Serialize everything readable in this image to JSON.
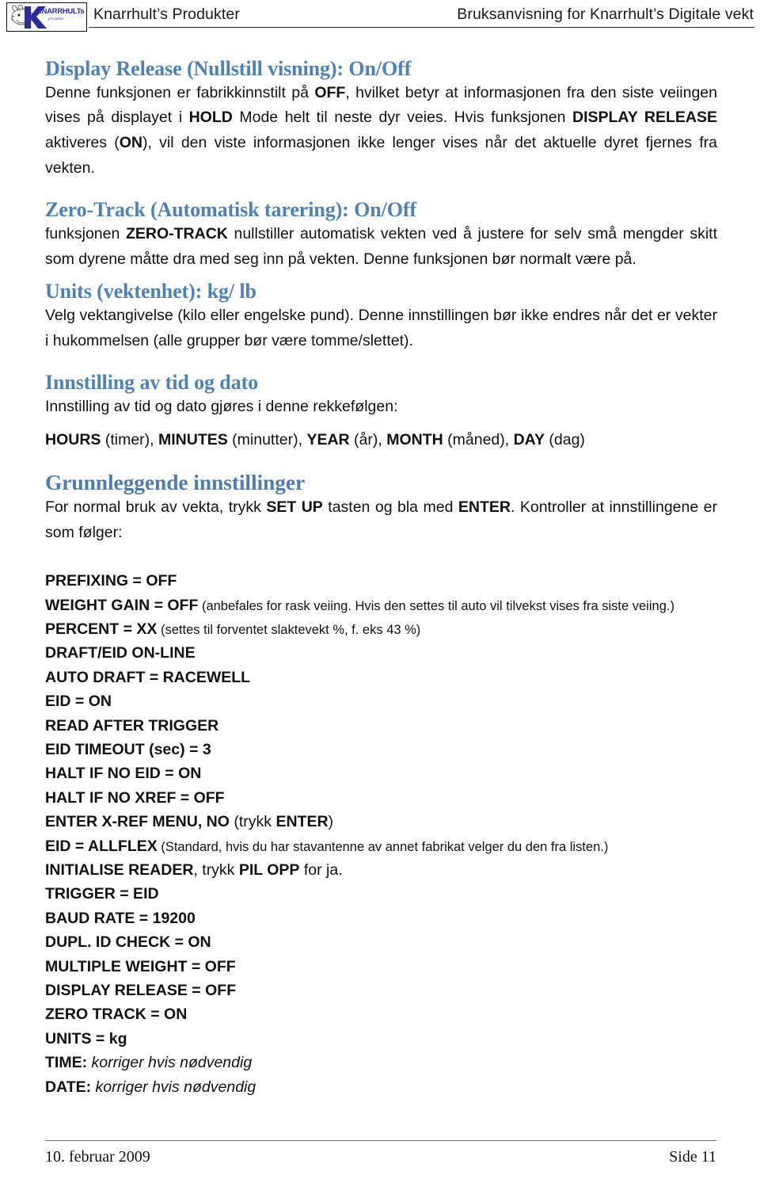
{
  "header": {
    "logo_alt": "Knarrhult's Produkter logo",
    "logo_brand": "KNARRHULTs",
    "logo_sub": "produkter",
    "left_title": "Knarrhult’s Produkter",
    "right_title": "Bruksanvisning for Knarrhult’s Digitale vekt"
  },
  "colors": {
    "heading_blue": "#4E81B6",
    "logo_blue": "#2B2B9E",
    "rule_gray": "#6F6F6F",
    "text_black": "#111111"
  },
  "sections": [
    {
      "heading": "Display Release (Nullstill visning): On/Off",
      "paragraphs": [
        {
          "runs": [
            {
              "t": "Denne funksjonen er fabrikkinnstilt på ",
              "b": false
            },
            {
              "t": "OFF",
              "b": true
            },
            {
              "t": ", hvilket betyr at informasjonen fra den siste veiingen vises på displayet i ",
              "b": false
            },
            {
              "t": "HOLD",
              "b": true
            },
            {
              "t": " Mode helt til neste dyr veies. Hvis funksjonen ",
              "b": false
            },
            {
              "t": "DISPLAY RELEASE",
              "b": true
            },
            {
              "t": " aktiveres (",
              "b": false
            },
            {
              "t": "ON",
              "b": true
            },
            {
              "t": "), vil den viste informasjonen ikke lenger vises når det aktuelle dyret fjernes fra vekten.",
              "b": false
            }
          ]
        }
      ]
    },
    {
      "heading": "Zero-Track (Automatisk tarering): On/Off",
      "paragraphs": [
        {
          "runs": [
            {
              "t": "funksjonen ",
              "b": false
            },
            {
              "t": "ZERO-TRACK",
              "b": true
            },
            {
              "t": " nullstiller automatisk vekten ved å justere for selv små mengder skitt som dyrene måtte dra med seg inn på vekten. Denne funksjonen bør normalt være på.",
              "b": false
            }
          ]
        }
      ]
    },
    {
      "heading": "Units (vektenhet): kg/ lb",
      "paragraphs": [
        {
          "runs": [
            {
              "t": "Velg  vektangivelse (kilo eller engelske pund).  Denne innstillingen bør ikke endres når det er vekter i hukommelsen (alle grupper bør være tomme/slettet).",
              "b": false
            }
          ]
        }
      ]
    },
    {
      "heading": "Innstilling av tid og dato",
      "paragraphs": [
        {
          "runs": [
            {
              "t": "Innstilling av tid og dato gjøres i denne rekkefølgen:",
              "b": false
            }
          ]
        },
        {
          "runs": [
            {
              "t": "HOURS",
              "b": true
            },
            {
              "t": " (timer), ",
              "b": false
            },
            {
              "t": "MINUTES",
              "b": true
            },
            {
              "t": " (minutter), ",
              "b": false
            },
            {
              "t": "YEAR",
              "b": true
            },
            {
              "t": " (år), ",
              "b": false
            },
            {
              "t": "MONTH",
              "b": true
            },
            {
              "t": " (måned), ",
              "b": false
            },
            {
              "t": "DAY",
              "b": true
            },
            {
              "t": " (dag)",
              "b": false
            }
          ]
        }
      ]
    },
    {
      "heading": "Grunnleggende innstillinger",
      "paragraphs": [
        {
          "runs": [
            {
              "t": "For normal bruk av vekta, trykk ",
              "b": false
            },
            {
              "t": "SET UP",
              "b": true
            },
            {
              "t": " tasten og bla med ",
              "b": false
            },
            {
              "t": "ENTER",
              "b": true
            },
            {
              "t": ". Kontroller at innstillingene er som følger:",
              "b": false
            }
          ]
        }
      ]
    }
  ],
  "settings": [
    {
      "key": "PREFIXING = OFF"
    },
    {
      "key": "WEIGHT GAIN = OFF",
      "note": " (anbefales for rask veiing. Hvis den settes til auto vil tilvekst vises fra siste veiing.)"
    },
    {
      "key": "PERCENT = XX",
      "note": " (settes til forventet slaktevekt %, f. eks 43 %)"
    },
    {
      "key": "DRAFT/EID ON-LINE"
    },
    {
      "key": "AUTO DRAFT = RACEWELL"
    },
    {
      "key": "EID = ON"
    },
    {
      "key": "READ AFTER TRIGGER"
    },
    {
      "key": "EID TIMEOUT (sec) = 3"
    },
    {
      "key": "HALT IF NO EID = ON"
    },
    {
      "key": "HALT IF NO XREF = OFF"
    },
    {
      "key": "ENTER X-REF MENU, NO",
      "plain": " (trykk ",
      "key2": "ENTER",
      "plain2": ")"
    },
    {
      "key": "EID = ALLFLEX",
      "note": " (Standard, hvis du har stavantenne av annet fabrikat velger du den fra listen.)"
    },
    {
      "key": "INITIALISE READER",
      "plain": ", trykk ",
      "key2": "PIL OPP",
      "plain2": " for ja."
    },
    {
      "key": "TRIGGER = EID"
    },
    {
      "key": "BAUD RATE = 19200"
    },
    {
      "key": "DUPL. ID CHECK = ON"
    },
    {
      "key": "MULTIPLE WEIGHT = OFF"
    },
    {
      "key": "DISPLAY RELEASE = OFF"
    },
    {
      "key": "ZERO TRACK = ON"
    },
    {
      "key": "UNITS = kg"
    },
    {
      "key": "TIME:",
      "ital": " korriger hvis nødvendig"
    },
    {
      "key": "DATE:",
      "ital": " korriger hvis nødvendig"
    }
  ],
  "footer": {
    "date": "10. februar 2009",
    "page": "Side 11"
  }
}
